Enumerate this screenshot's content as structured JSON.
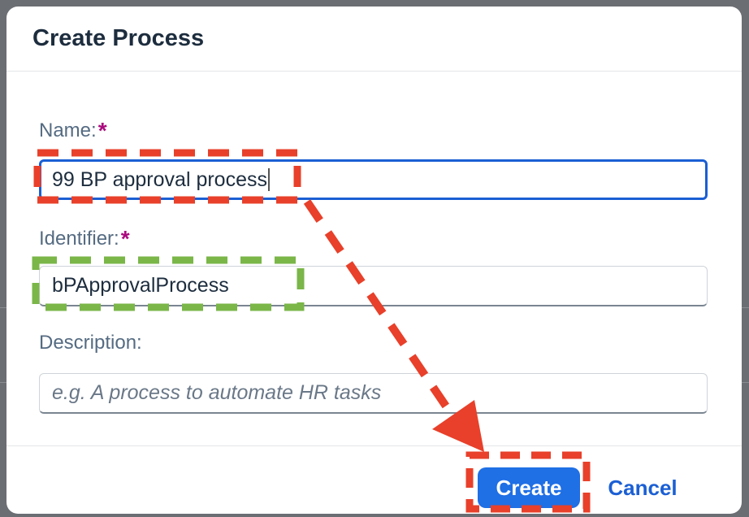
{
  "dialog": {
    "title": "Create Process"
  },
  "form": {
    "name": {
      "label": "Name:",
      "required_mark": "*",
      "value": "99 BP approval process"
    },
    "identifier": {
      "label": "Identifier:",
      "required_mark": "*",
      "value": "bPApprovalProcess"
    },
    "description": {
      "label": "Description:",
      "placeholder": "e.g. A process to automate HR tasks",
      "value": ""
    }
  },
  "footer": {
    "create_label": "Create",
    "cancel_label": "Cancel"
  },
  "colors": {
    "accent": "#1f6fe5",
    "required": "#aa0a7d",
    "annotation_red": "#e8402a",
    "annotation_green": "#7ab648"
  }
}
